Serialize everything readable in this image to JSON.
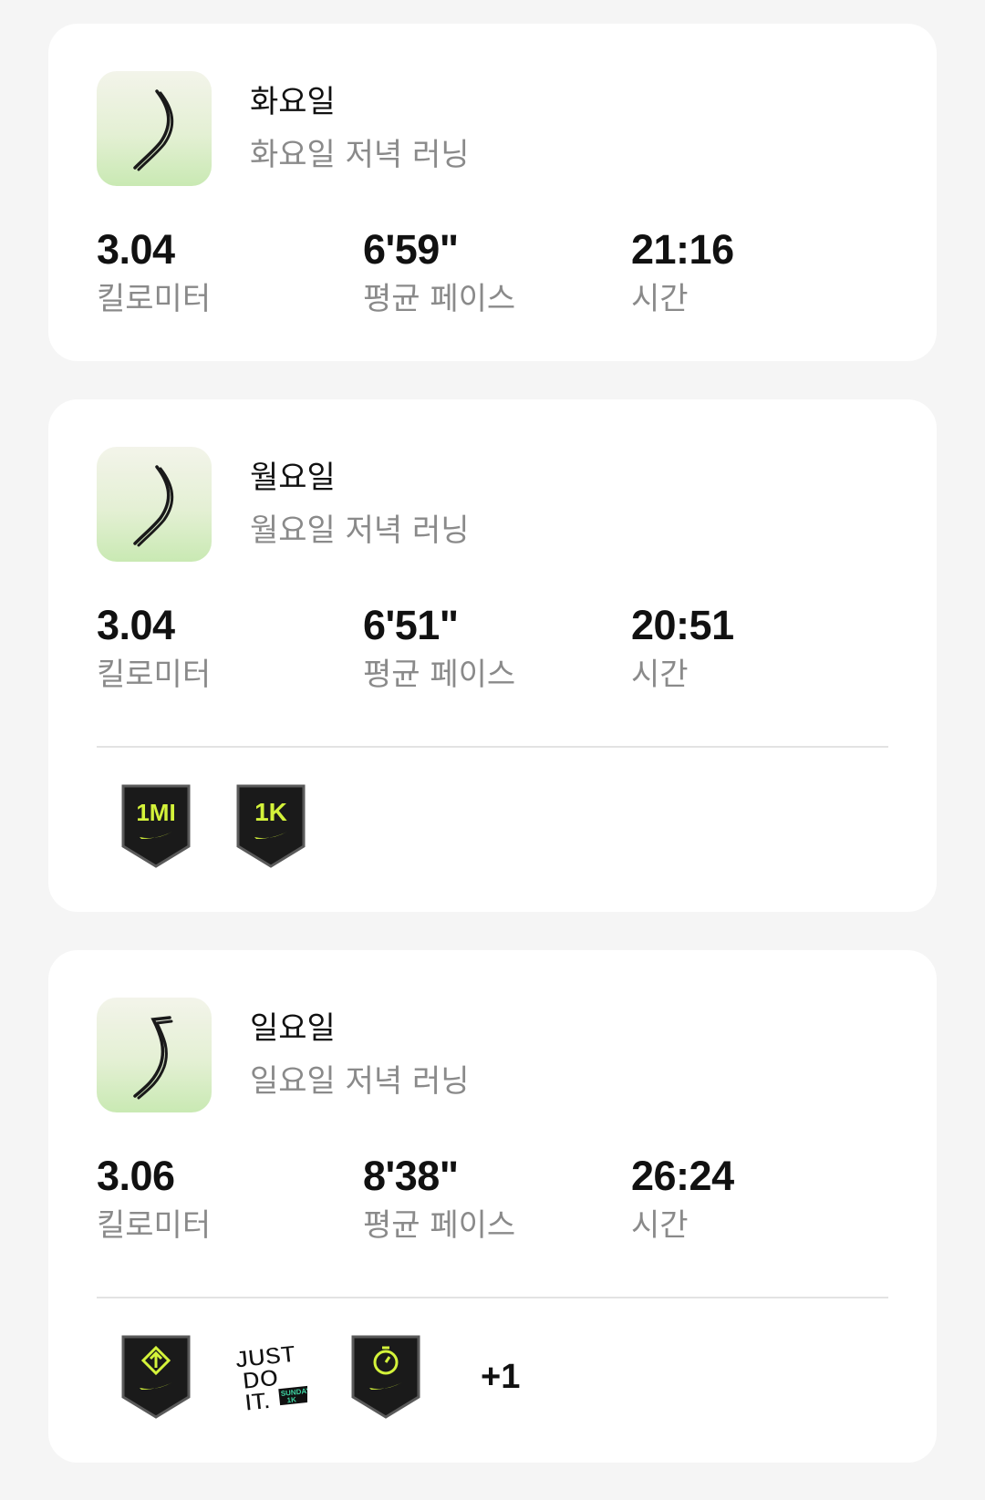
{
  "activities": [
    {
      "day": "화요일",
      "name": "화요일 저녁 러닝",
      "stats": [
        {
          "value": "3.04",
          "label": "킬로미터"
        },
        {
          "value": "6'59\"",
          "label": "평균 페이스"
        },
        {
          "value": "21:16",
          "label": "시간"
        }
      ],
      "badges": []
    },
    {
      "day": "월요일",
      "name": "월요일 저녁 러닝",
      "stats": [
        {
          "value": "3.04",
          "label": "킬로미터"
        },
        {
          "value": "6'51\"",
          "label": "평균 페이스"
        },
        {
          "value": "20:51",
          "label": "시간"
        }
      ],
      "badges": [
        {
          "text": "1MI",
          "icon": "1-mile-badge-icon"
        },
        {
          "text": "1K",
          "icon": "1k-badge-icon"
        }
      ]
    },
    {
      "day": "일요일",
      "name": "일요일 저녁 러닝",
      "stats": [
        {
          "value": "3.06",
          "label": "킬로미터"
        },
        {
          "value": "8'38\"",
          "label": "평균 페이스"
        },
        {
          "value": "26:24",
          "label": "시간"
        }
      ],
      "badges": [
        {
          "icon": "elevation-badge-icon"
        },
        {
          "text": "JUST DO IT. SUNDAY 1K",
          "icon": "just-do-it-sunday-1k-badge-icon"
        },
        {
          "icon": "stopwatch-badge-icon"
        }
      ],
      "more_badges": "+1"
    }
  ],
  "colors": {
    "badge_bg": "#1a1a1a",
    "badge_accent": "#d4f33a",
    "sunday_accent": "#3fd6a4"
  }
}
